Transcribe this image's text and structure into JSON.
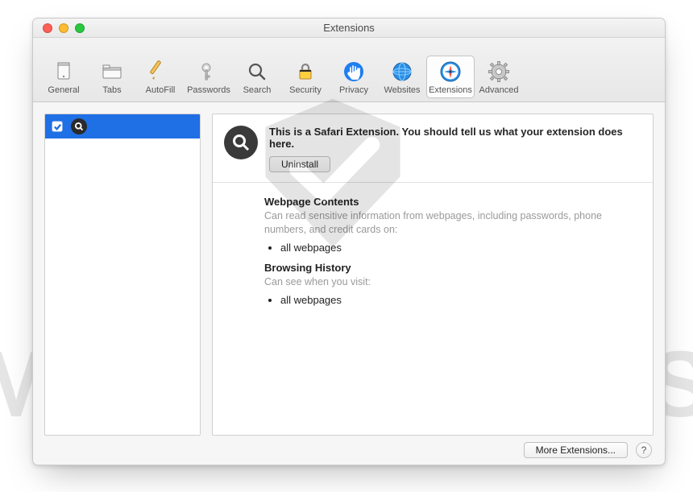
{
  "window": {
    "title": "Extensions"
  },
  "toolbar": {
    "items": [
      {
        "label": "General"
      },
      {
        "label": "Tabs"
      },
      {
        "label": "AutoFill"
      },
      {
        "label": "Passwords"
      },
      {
        "label": "Search"
      },
      {
        "label": "Security"
      },
      {
        "label": "Privacy"
      },
      {
        "label": "Websites"
      },
      {
        "label": "Extensions"
      },
      {
        "label": "Advanced"
      }
    ],
    "selected_index": 8
  },
  "sidebar": {
    "items": [
      {
        "checked": true,
        "icon": "magnifier-icon",
        "name": ""
      }
    ]
  },
  "detail": {
    "description": "This is a Safari Extension. You should tell us what your extension does here.",
    "uninstall_label": "Uninstall",
    "sections": [
      {
        "heading": "Webpage Contents",
        "subtext": "Can read sensitive information from webpages, including passwords, phone numbers, and credit cards on:",
        "bullets": [
          "all webpages"
        ]
      },
      {
        "heading": "Browsing History",
        "subtext": "Can see when you visit:",
        "bullets": [
          "all webpages"
        ]
      }
    ]
  },
  "footer": {
    "more_label": "More Extensions...",
    "help_label": "?"
  },
  "watermark": "MALWARETIPS"
}
